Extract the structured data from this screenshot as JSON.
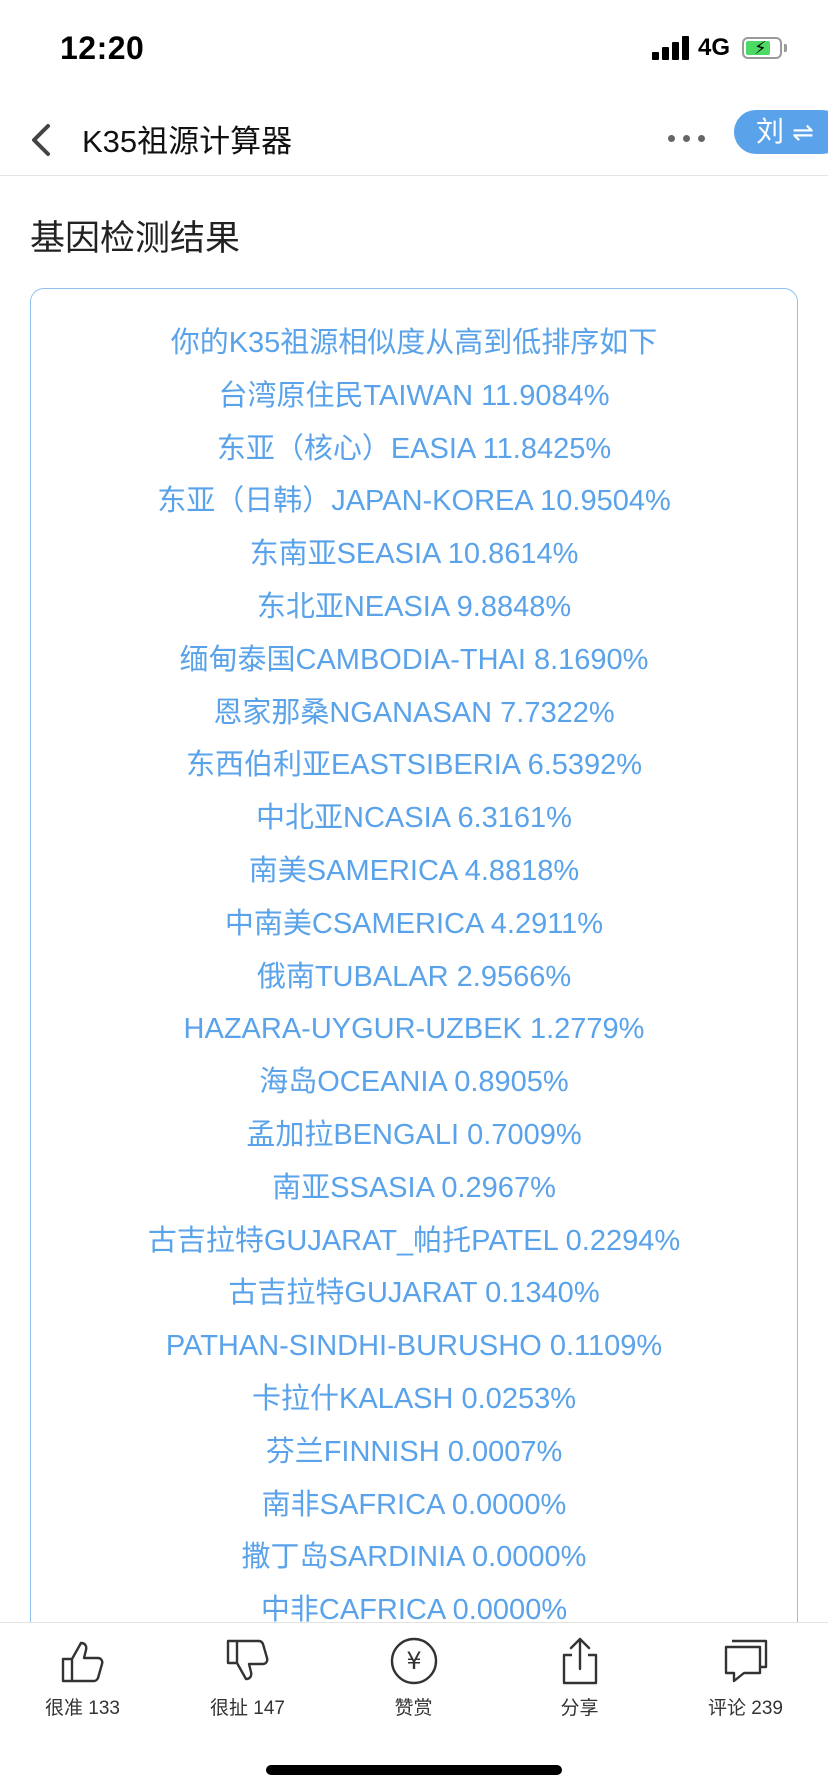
{
  "status_bar": {
    "time": "12:20",
    "network": "4G"
  },
  "nav": {
    "title": "K35祖源计算器",
    "user_label": "刘",
    "swap_icon": "⇌"
  },
  "section_title": "基因检测结果",
  "results": [
    "你的K35祖源相似度从高到低排序如下",
    "台湾原住民TAIWAN 11.9084%",
    "东亚（核心）EASIA 11.8425%",
    "东亚（日韩）JAPAN-KOREA 10.9504%",
    "东南亚SEASIA 10.8614%",
    "东北亚NEASIA 9.8848%",
    "缅甸泰国CAMBODIA-THAI 8.1690%",
    "恩家那桑NGANASAN 7.7322%",
    "东西伯利亚EASTSIBERIA 6.5392%",
    "中北亚NCASIA 6.3161%",
    "南美SAMERICA 4.8818%",
    "中南美CSAMERICA 4.2911%",
    "俄南TUBALAR 2.9566%",
    "HAZARA-UYGUR-UZBEK 1.2779%",
    "海岛OCEANIA 0.8905%",
    "孟加拉BENGALI 0.7009%",
    "南亚SSASIA 0.2967%",
    "古吉拉特GUJARAT_帕托PATEL 0.2294%",
    "古吉拉特GUJARAT 0.1340%",
    "PATHAN-SINDHI-BURUSHO 0.1109%",
    "卡拉什KALASH 0.0253%",
    "芬兰FINNISH 0.0007%",
    "南非SAFRICA 0.0000%",
    "撒丁岛SARDINIA 0.0000%",
    "中非CAFRICA 0.0000%"
  ],
  "toolbar": {
    "like_label": "很准 133",
    "dislike_label": "很扯 147",
    "tip_label": "赞赏",
    "share_label": "分享",
    "comment_label": "评论 239",
    "yen_glyph": "¥"
  },
  "colors": {
    "accent": "#5aa3ea",
    "card_border": "#8fc0ef",
    "battery": "#4cd964"
  },
  "icons": [
    "back-chevron-icon",
    "more-dots-icon",
    "thumbs-up-icon",
    "thumbs-down-icon",
    "yen-circle-icon",
    "share-icon",
    "comment-icon"
  ]
}
